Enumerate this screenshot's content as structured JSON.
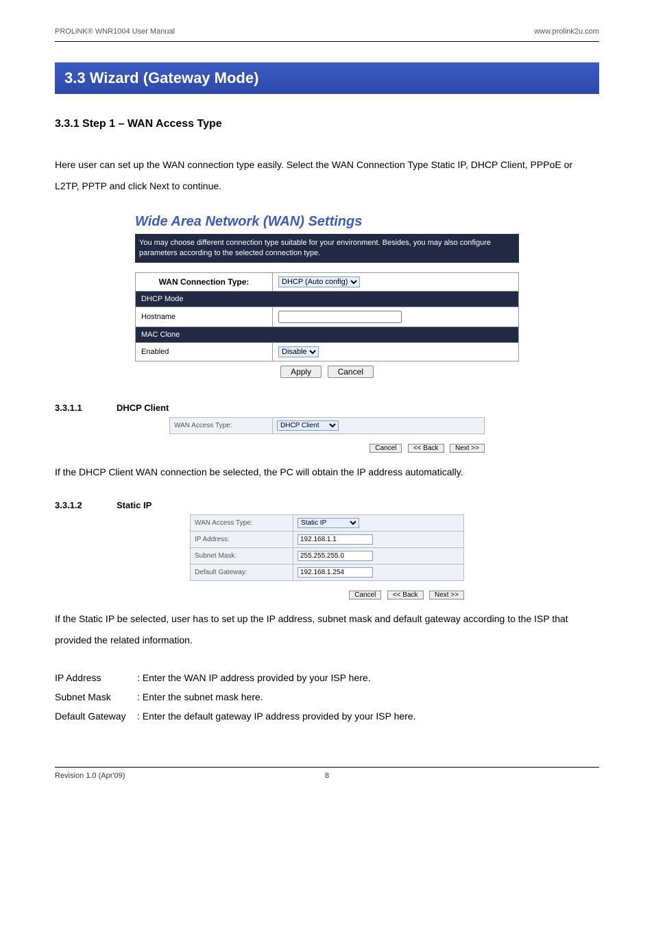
{
  "header": {
    "left": "PROLiNK® WNR1004 User Manual",
    "right": "www.prolink2u.com"
  },
  "section_banner": "3.3   Wizard (Gateway Mode)",
  "sub1": "3.3.1   Step 1 – WAN Access Type",
  "intro": "Here user can set up the WAN connection type easily. Select the WAN Connection Type Static IP, DHCP Client, PPPoE or L2TP, PPTP and click Next to continue.",
  "wan": {
    "title": "Wide Area Network (WAN) Settings",
    "desc": "You may choose different connection type suitable for your environment. Besides, you may also configure parameters according to the selected connection type.",
    "conn_type_label": "WAN Connection Type:",
    "conn_type_value": "DHCP (Auto config)",
    "dhcp_mode": "DHCP Mode",
    "hostname_label": "Hostname",
    "hostname_value": "",
    "mac_clone": "MAC Clone",
    "enabled_label": "Enabled",
    "enabled_value": "Disable",
    "apply": "Apply",
    "cancel": "Cancel"
  },
  "sec_3_3_1_1": {
    "num": "3.3.1.1",
    "title": "DHCP Client"
  },
  "dhcp_mini": {
    "label": "WAN Access Type:",
    "value": "DHCP Client",
    "cancel": "Cancel",
    "back": "<< Back",
    "next": "Next >>"
  },
  "dhcp_text": "If the DHCP Client WAN connection be selected, the PC will obtain the IP address automatically.",
  "sec_3_3_1_2": {
    "num": "3.3.1.2",
    "title": "Static IP"
  },
  "static_mini": {
    "access_label": "WAN Access Type:",
    "access_value": "Static IP",
    "ip_label": "IP Address:",
    "ip_value": "192.168.1.1",
    "mask_label": "Subnet Mask:",
    "mask_value": "255.255.255.0",
    "gw_label": "Default Gateway:",
    "gw_value": "192.168.1.254",
    "cancel": "Cancel",
    "back": "<< Back",
    "next": "Next >>"
  },
  "static_text": "If the Static IP be selected, user has to set up the IP address, subnet mask and default gateway according to the ISP that provided the related information.",
  "defs": {
    "ip": {
      "term": "IP Address",
      "desc": ": Enter the WAN IP address provided by your ISP here."
    },
    "mask": {
      "term": "Subnet Mask",
      "desc": ": Enter the subnet mask here."
    },
    "gw": {
      "term": "Default Gateway",
      "desc": ": Enter the default gateway IP address provided by your ISP here."
    }
  },
  "footer": {
    "left": "Revision 1.0 (Apr'09)",
    "center": "8"
  }
}
